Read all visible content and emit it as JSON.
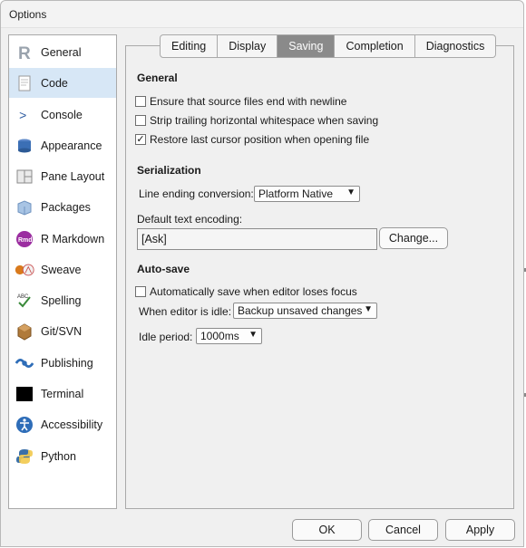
{
  "window": {
    "title": "Options"
  },
  "sidebar": {
    "items": [
      {
        "label": "General",
        "icon": "r-logo-icon",
        "active": false
      },
      {
        "label": "Code",
        "icon": "code-document-icon",
        "active": true
      },
      {
        "label": "Console",
        "icon": "console-prompt-icon",
        "active": false
      },
      {
        "label": "Appearance",
        "icon": "appearance-stack-icon",
        "active": false
      },
      {
        "label": "Pane Layout",
        "icon": "pane-layout-icon",
        "active": false
      },
      {
        "label": "Packages",
        "icon": "package-cube-icon",
        "active": false
      },
      {
        "label": "R Markdown",
        "icon": "rmarkdown-icon",
        "active": false
      },
      {
        "label": "Sweave",
        "icon": "sweave-icon",
        "active": false
      },
      {
        "label": "Spelling",
        "icon": "spelling-check-icon",
        "active": false
      },
      {
        "label": "Git/SVN",
        "icon": "git-box-icon",
        "active": false
      },
      {
        "label": "Publishing",
        "icon": "publishing-icon",
        "active": false
      },
      {
        "label": "Terminal",
        "icon": "terminal-icon",
        "active": false
      },
      {
        "label": "Accessibility",
        "icon": "accessibility-icon",
        "active": false
      },
      {
        "label": "Python",
        "icon": "python-icon",
        "active": false
      }
    ]
  },
  "tabs": [
    {
      "label": "Editing",
      "active": false
    },
    {
      "label": "Display",
      "active": false
    },
    {
      "label": "Saving",
      "active": true
    },
    {
      "label": "Completion",
      "active": false
    },
    {
      "label": "Diagnostics",
      "active": false
    }
  ],
  "general": {
    "title": "General",
    "options": [
      {
        "label": "Ensure that source files end with newline",
        "checked": false
      },
      {
        "label": "Strip trailing horizontal whitespace when saving",
        "checked": false
      },
      {
        "label": "Restore last cursor position when opening file",
        "checked": true
      }
    ]
  },
  "serialization": {
    "title": "Serialization",
    "line_ending_label": "Line ending conversion:",
    "line_ending_value": "Platform Native",
    "encoding_label": "Default text encoding:",
    "encoding_value": "[Ask]",
    "change_button": "Change..."
  },
  "autosave": {
    "title": "Auto-save",
    "option_label": "Automatically save when editor loses focus",
    "option_checked": false,
    "idle_label": "When editor is idle:",
    "idle_value": "Backup unsaved changes",
    "period_label": "Idle period:",
    "period_value": "1000ms"
  },
  "footer": {
    "ok": "OK",
    "cancel": "Cancel",
    "apply": "Apply"
  },
  "colors": {
    "active_tab": "#8a8a8a",
    "active_sidebar": "#d7e7f6"
  }
}
